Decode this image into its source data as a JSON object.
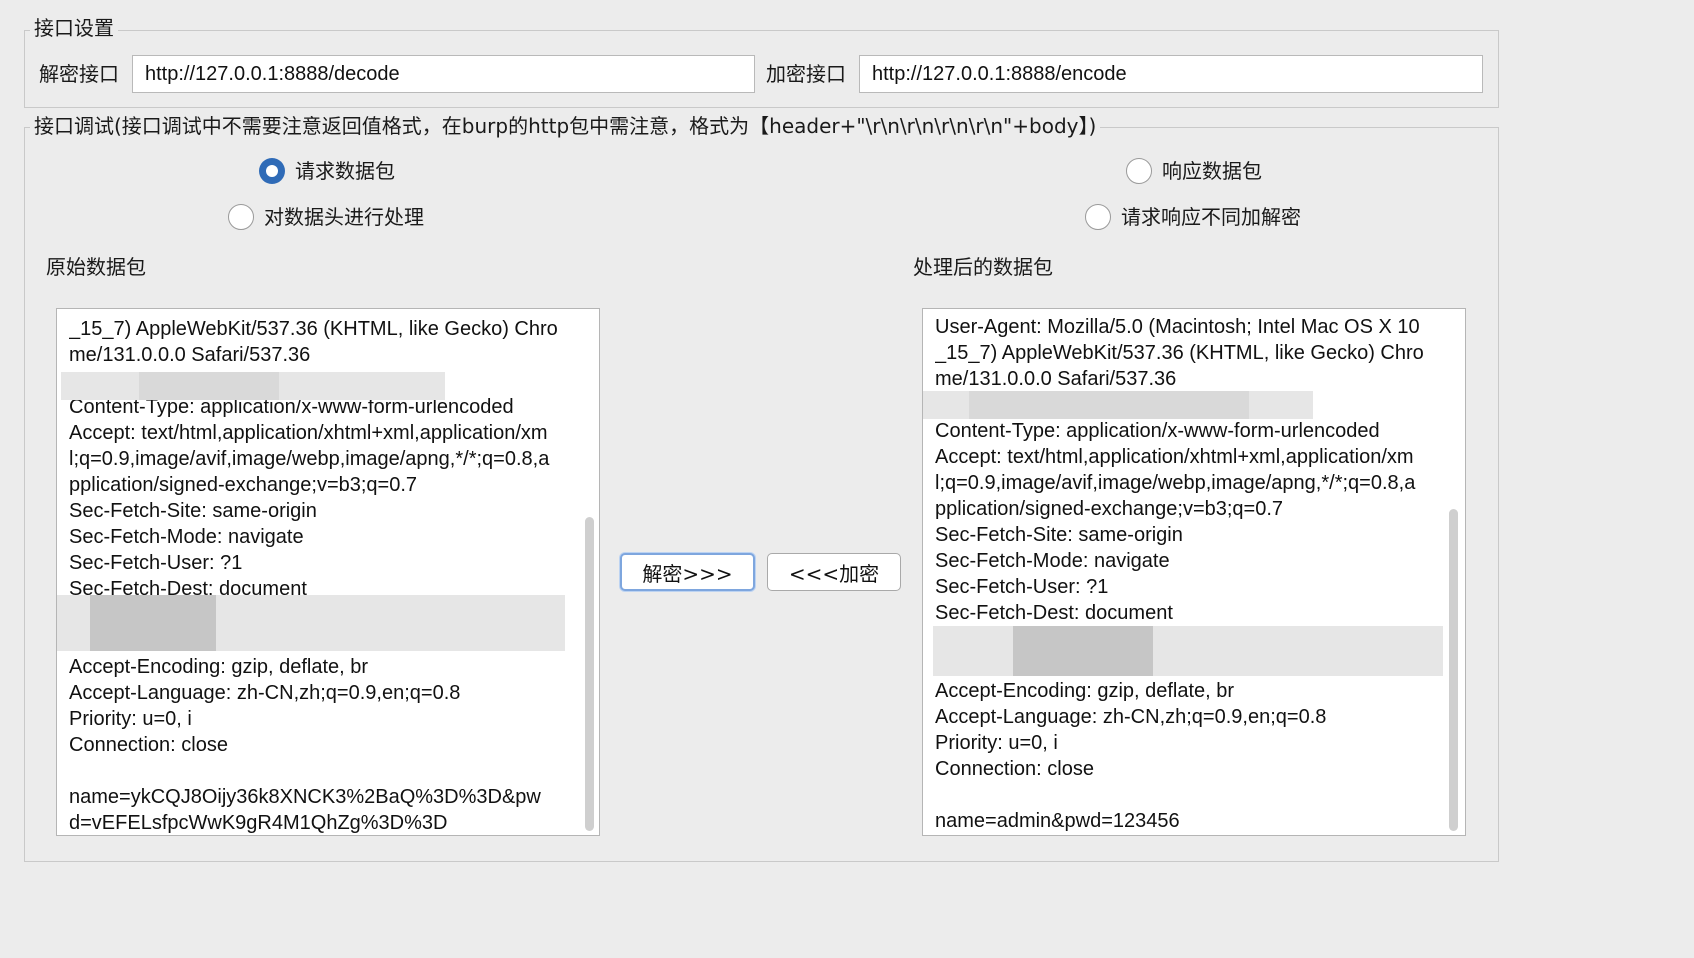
{
  "interface_settings": {
    "legend": "接口设置",
    "decrypt_label": "解密接口",
    "decrypt_url": "http://127.0.0.1:8888/decode",
    "encrypt_label": "加密接口",
    "encrypt_url": "http://127.0.0.1:8888/encode"
  },
  "debug": {
    "legend": "接口调试(接口调试中不需要注意返回值格式，在burp的http包中需注意，格式为【header+\"\\r\\n\\r\\n\\r\\n\\r\\n\"+body】)",
    "radio_request": "请求数据包",
    "radio_request_checked": true,
    "radio_response": "响应数据包",
    "radio_header": "对数据头进行处理",
    "radio_diff": "请求响应不同加解密",
    "original_label": "原始数据包",
    "processed_label": "处理后的数据包",
    "decrypt_button": "解密>>>",
    "encrypt_button": "<<<加密",
    "original_lines": [
      "_15_7) AppleWebKit/537.36 (KHTML, like Gecko) Chro",
      "me/131.0.0.0 Safari/537.36",
      "",
      "Content-Type: application/x-www-form-urlencoded",
      "Accept: text/html,application/xhtml+xml,application/xm",
      "l;q=0.9,image/avif,image/webp,image/apng,*/*;q=0.8,a",
      "pplication/signed-exchange;v=b3;q=0.7",
      "Sec-Fetch-Site: same-origin",
      "Sec-Fetch-Mode: navigate",
      "Sec-Fetch-User: ?1",
      "Sec-Fetch-Dest: document",
      "",
      "",
      "Accept-Encoding: gzip, deflate, br",
      "Accept-Language: zh-CN,zh;q=0.9,en;q=0.8",
      "Priority: u=0, i",
      "Connection: close",
      "",
      "name=ykCQJ8Oijy36k8XNCK3%2BaQ%3D%3D&pw",
      "d=vEFELsfpcWwK9gR4M1QhZg%3D%3D"
    ],
    "processed_lines": [
      "User-Agent: Mozilla/5.0 (Macintosh; Intel Mac OS X 10",
      "_15_7) AppleWebKit/537.36 (KHTML, like Gecko) Chro",
      "me/131.0.0.0 Safari/537.36",
      "",
      "Content-Type: application/x-www-form-urlencoded",
      "Accept: text/html,application/xhtml+xml,application/xm",
      "l;q=0.9,image/avif,image/webp,image/apng,*/*;q=0.8,a",
      "pplication/signed-exchange;v=b3;q=0.7",
      "Sec-Fetch-Site: same-origin",
      "Sec-Fetch-Mode: navigate",
      "Sec-Fetch-User: ?1",
      "Sec-Fetch-Dest: document",
      "",
      "",
      "Accept-Encoding: gzip, deflate, br",
      "Accept-Language: zh-CN,zh;q=0.9,en;q=0.8",
      "Priority: u=0, i",
      "Connection: close",
      "",
      "name=admin&pwd=123456"
    ]
  }
}
